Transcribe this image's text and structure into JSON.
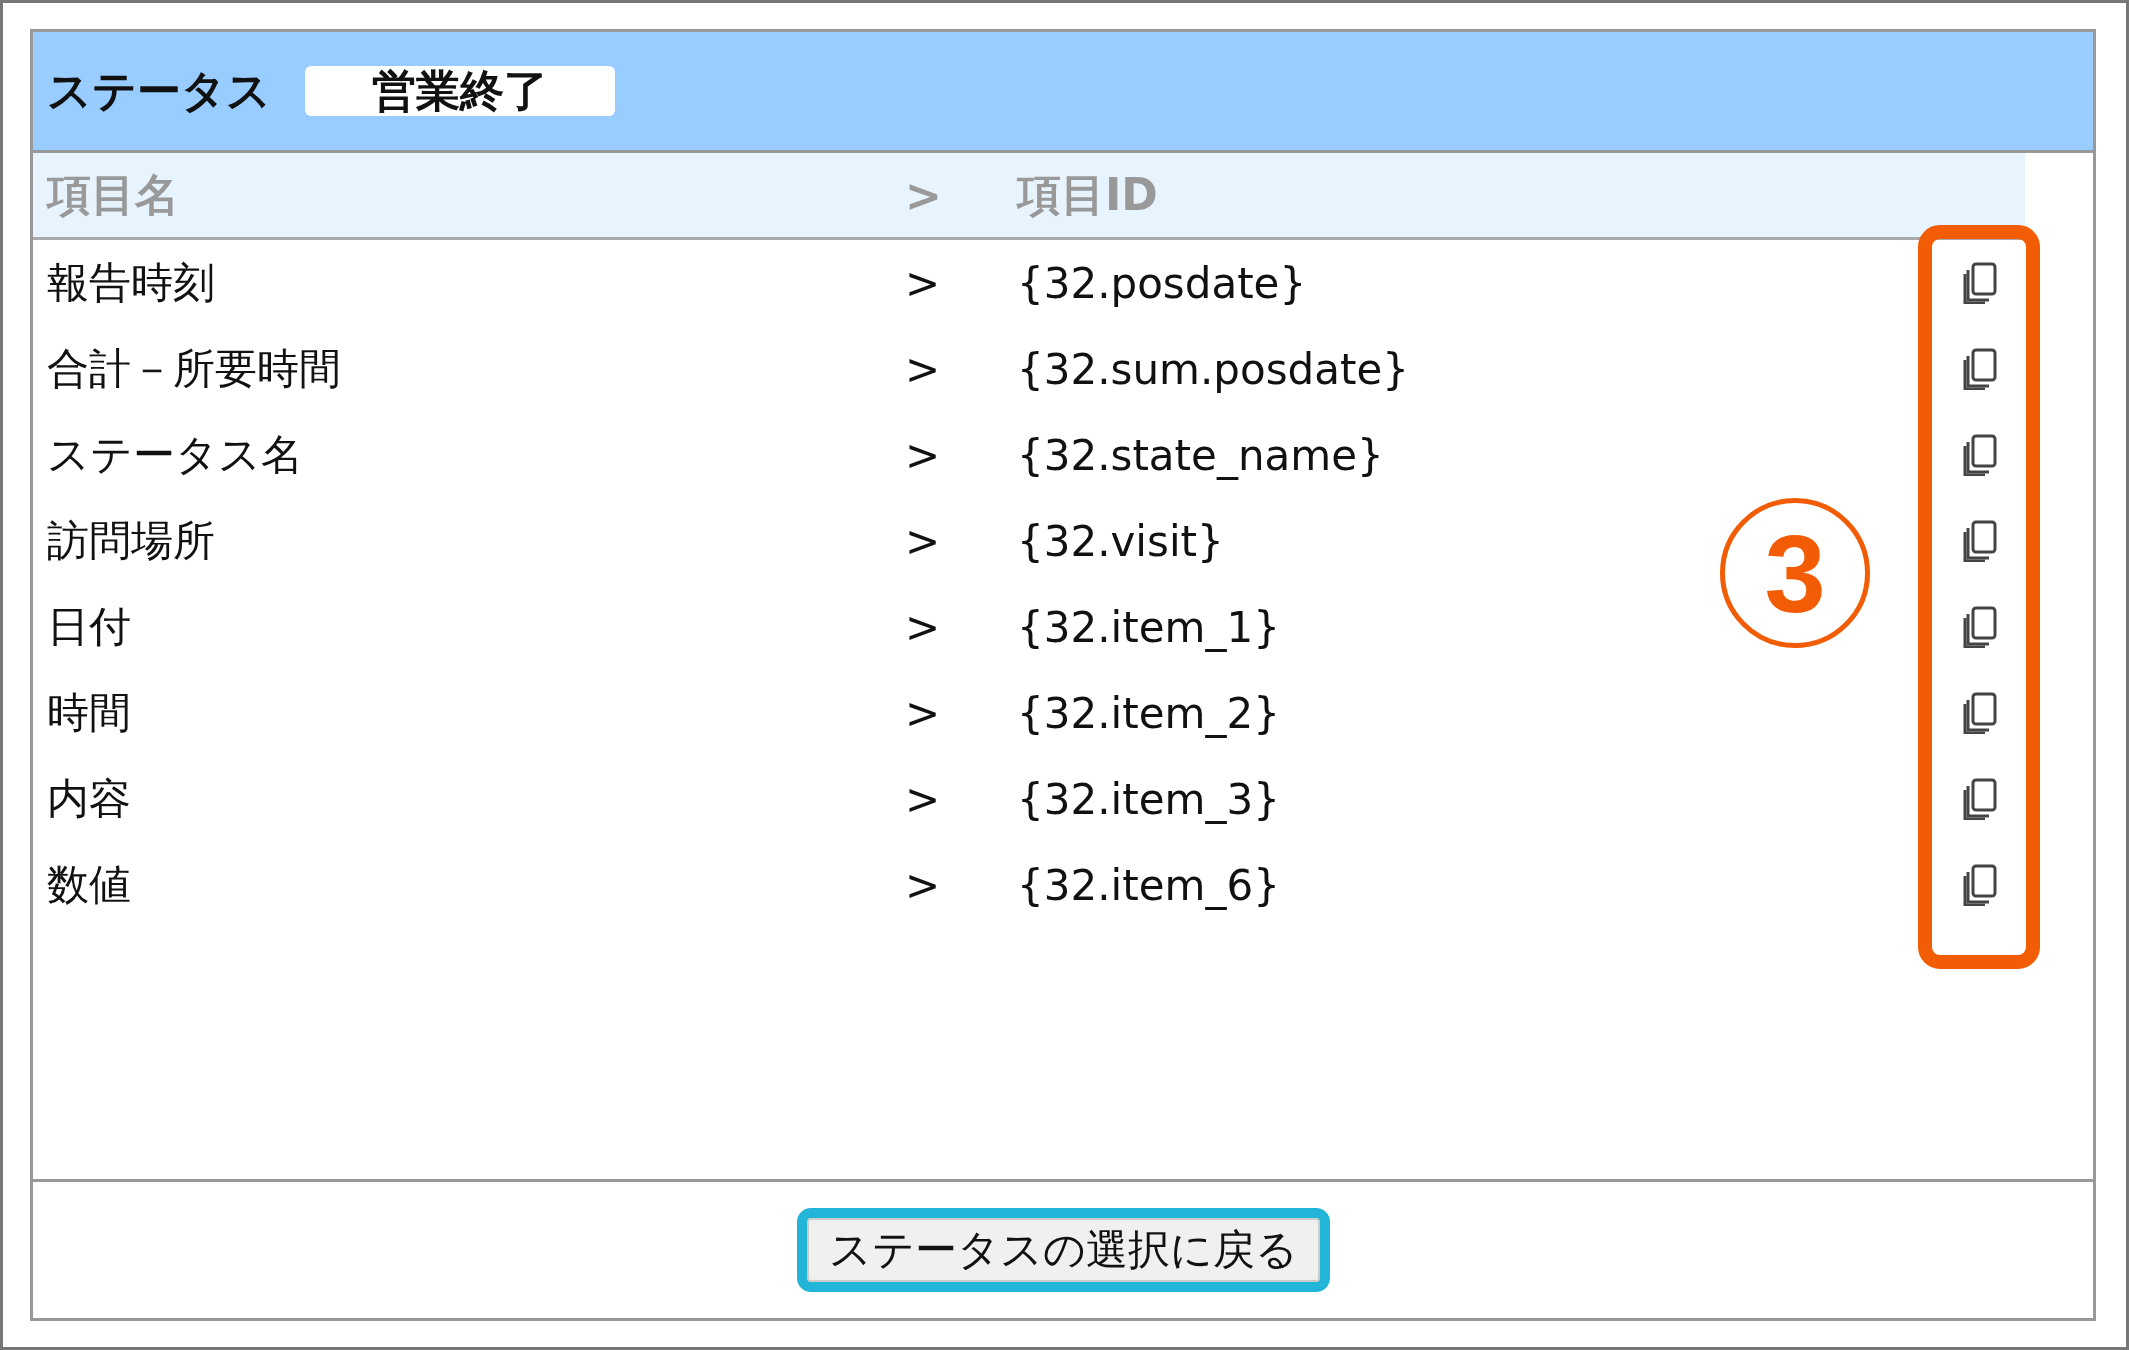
{
  "header": {
    "label": "ステータス",
    "status": "営業終了"
  },
  "columns": [
    "項目名",
    ">",
    "項目ID"
  ],
  "rows": [
    {
      "name": "報告時刻",
      "arrow": ">",
      "id": "{32.posdate}"
    },
    {
      "name": "合計－所要時間",
      "arrow": ">",
      "id": "{32.sum.posdate}"
    },
    {
      "name": "ステータス名",
      "arrow": ">",
      "id": "{32.state_name}"
    },
    {
      "name": "訪問場所",
      "arrow": ">",
      "id": "{32.visit}"
    },
    {
      "name": "日付",
      "arrow": ">",
      "id": "{32.item_1}"
    },
    {
      "name": "時間",
      "arrow": ">",
      "id": "{32.item_2}"
    },
    {
      "name": "内容",
      "arrow": ">",
      "id": "{32.item_3}"
    },
    {
      "name": "数値",
      "arrow": ">",
      "id": "{32.item_6}"
    }
  ],
  "back_button": "ステータスの選択に戻る",
  "annotation": {
    "label": "3"
  }
}
